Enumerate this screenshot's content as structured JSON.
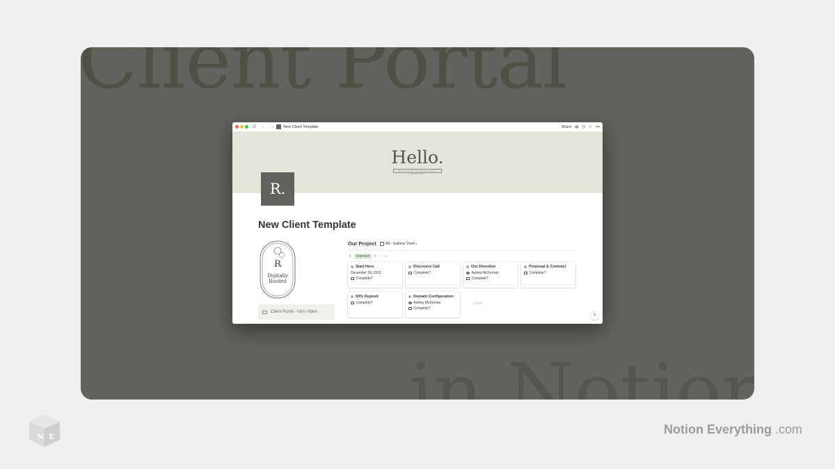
{
  "background": {
    "title": "Client Portal",
    "subtitle": "in Notion"
  },
  "window": {
    "tab_title": "New Client Template",
    "share_label": "Share",
    "cover": {
      "heading": "Hello.",
      "subtext": "WELCOME TO DIGITALLY ROOTED"
    },
    "page_icon_letter": "R.",
    "page_title": "New Client Template",
    "logo": {
      "letter": "R",
      "line1": "Digitally",
      "line2": "Rooted"
    },
    "video_label": "Client Portal - Intro Video",
    "database": {
      "title": "Our Project",
      "view_label": "All - Gallery View",
      "group_label": "Onboard",
      "group_count": "6",
      "new_label": "+ New",
      "cards": [
        {
          "title": "Start Here",
          "line1": "December 30, 2021",
          "line2": "Complete?"
        },
        {
          "title": "Discovery Call",
          "line1": "Complete?",
          "line2": ""
        },
        {
          "title": "Our Direction",
          "line1": "Ashley McKernan",
          "line2": "Complete?"
        },
        {
          "title": "Proposal & Contract",
          "line1": "Complete?",
          "line2": ""
        },
        {
          "title": "50% Deposit",
          "line1": "Complete?",
          "line2": ""
        },
        {
          "title": "Domain Configuration",
          "line1": "Ashley McKernan",
          "line2": "Complete?"
        }
      ]
    },
    "help_label": "?"
  },
  "footer": {
    "brand_name": "Notion Everything",
    "brand_tld": ".com",
    "logo_letters": "NE"
  },
  "colors": {
    "stage": "#62635c",
    "cover": "#e5e4d9",
    "page_bg": "#efefef"
  }
}
